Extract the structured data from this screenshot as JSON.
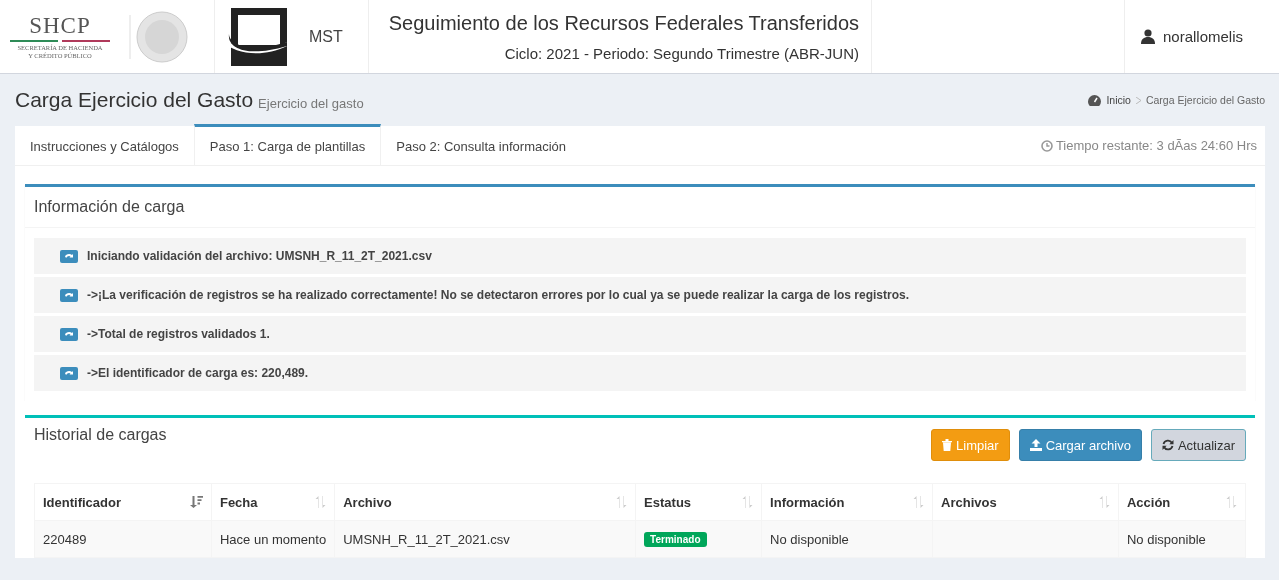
{
  "header": {
    "logo_text": "SHCP",
    "logo_lines": [
      "SECRETARÍA DE HACIENDA",
      "Y CRÉDITO PÚBLICO"
    ],
    "mst_label": "MST",
    "title": "Seguimiento de los Recursos Federales Transferidos",
    "subtitle": "Ciclo: 2021 - Periodo: Segundo Trimestre (ABR-JUN)",
    "user": "norallomelis"
  },
  "page": {
    "title": "Carga Ejercicio del Gasto",
    "subtitle": "Ejercicio del gasto",
    "breadcrumb": [
      "Inicio",
      "Carga Ejercicio del Gasto"
    ]
  },
  "tabs": [
    {
      "label": "Instrucciones y Catálogos",
      "selected": false
    },
    {
      "label": "Paso 1: Carga de plantillas",
      "selected": true
    },
    {
      "label": "Paso 2: Consulta información",
      "selected": false
    }
  ],
  "time_remaining": "Tiempo restante: 3 dÃas 24:60 Hrs",
  "info_box": {
    "title": "Información de carga",
    "messages": [
      "Iniciando validación del archivo: UMSNH_R_11_2T_2021.csv",
      "->¡La verificación de registros se ha realizado correctamente! No se detectaron errores por lo cual ya se puede realizar la carga de los registros.",
      "->Total de registros validados 1.",
      "->El identificador de carga es: 220,489."
    ]
  },
  "history": {
    "title": "Historial de cargas",
    "buttons": [
      {
        "label": "Limpiar",
        "kind": "warning"
      },
      {
        "label": "Cargar archivo",
        "kind": "primary"
      },
      {
        "label": "Actualizar",
        "kind": "default"
      }
    ],
    "columns": [
      {
        "label": "Identificador",
        "sorted": true
      },
      {
        "label": "Fecha",
        "sorted": false
      },
      {
        "label": "Archivo",
        "sorted": false
      },
      {
        "label": "Estatus",
        "sorted": false
      },
      {
        "label": "Información",
        "sorted": false
      },
      {
        "label": "Archivos",
        "sorted": false
      },
      {
        "label": "Acción",
        "sorted": false
      }
    ],
    "rows": [
      {
        "id": "220489",
        "date": "Hace un momento",
        "file": "UMSNH_R_11_2T_2021.csv",
        "status": {
          "label": "Terminado",
          "kind": "success"
        },
        "info": "No disponible",
        "action": "No disponible"
      }
    ]
  }
}
